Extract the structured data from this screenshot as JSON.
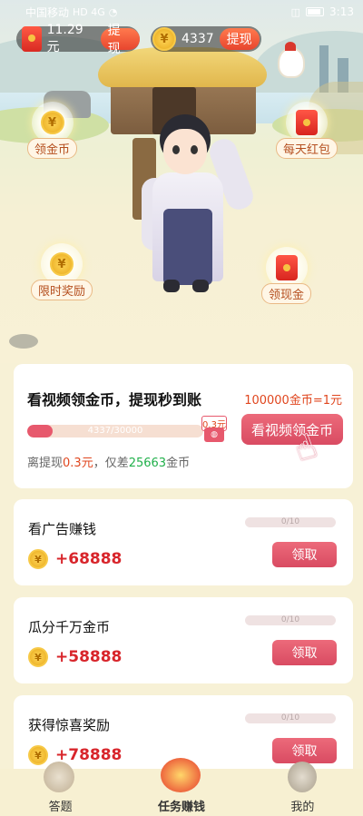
{
  "status_bar": {
    "carrier": "中国移动",
    "network": "HD 4G",
    "time": "3:13"
  },
  "wallet": {
    "cash_amount": "11.29元",
    "cash_withdraw_label": "提现",
    "coin_amount": "4337",
    "coin_withdraw_label": "提现",
    "coin_symbol": "¥"
  },
  "floating_actions": {
    "collect_coins": "领金币",
    "daily_red_packet": "每天红包",
    "limited_reward": "限时奖励",
    "collect_cash": "领现金"
  },
  "hero_card": {
    "title": "看视频领金币，提现秒到账",
    "rate": "100000金币=1元",
    "progress_text": "4337/30000",
    "progress_value": 0.1446,
    "badge_amount": "0.3元",
    "video_button": "看视频领金币",
    "note_prefix": "离提现",
    "note_cash": "0.3元",
    "note_middle": "，仅差",
    "note_coins": "25663",
    "note_suffix": "金币"
  },
  "tasks": [
    {
      "title": "看广告赚钱",
      "progress": "0/10",
      "reward": "+68888",
      "claim": "领取"
    },
    {
      "title": "瓜分千万金币",
      "progress": "0/10",
      "reward": "+58888",
      "claim": "领取"
    },
    {
      "title": "获得惊喜奖励",
      "progress": "0/10",
      "reward": "+78888",
      "claim": "领取"
    }
  ],
  "tabs": [
    {
      "label": "答题",
      "active": false
    },
    {
      "label": "任务赚钱",
      "active": true
    },
    {
      "label": "我的",
      "active": false
    }
  ],
  "colors": {
    "accent": "#e7596d",
    "orange": "#e0461e",
    "green": "#21b04b",
    "reward_red": "#d8252b"
  }
}
